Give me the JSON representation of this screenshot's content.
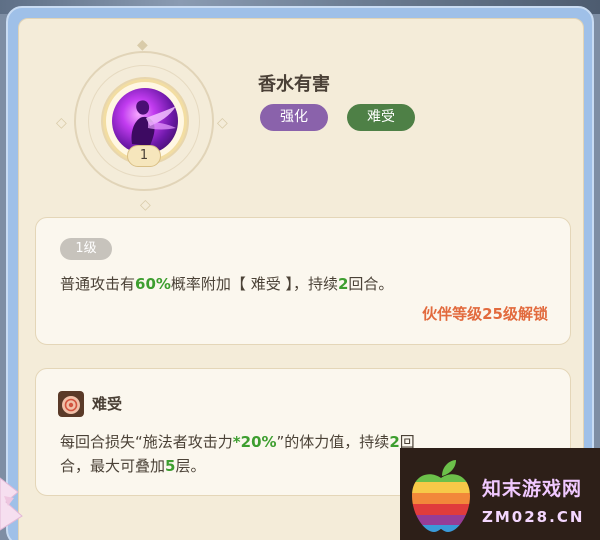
{
  "skill": {
    "name": "香水有害",
    "level_chip": "1",
    "tags": [
      {
        "label": "强化",
        "color": "#8a62ab"
      },
      {
        "label": "难受",
        "color": "#4e8046"
      }
    ]
  },
  "card_level": {
    "badge": "1级",
    "desc": {
      "p1": "普通攻击有",
      "chance": "60%",
      "p2": "概率附加【 难受 】，持续",
      "turns": "2",
      "p3": "回合。"
    },
    "unlock": "伙伴等级25级解锁"
  },
  "card_debuff": {
    "title": "难受",
    "desc": {
      "p1": "每回合损失“施法者攻击力",
      "percent": "*20%",
      "p2": "”的体力值，持续",
      "turns": "2",
      "p3": "回",
      "line2_p1": "合，最大可叠加",
      "stacks": "5",
      "line2_p2": "层。"
    }
  },
  "watermark": {
    "cn": "知末游戏网",
    "en": "ZM028.CN"
  },
  "colors": {
    "highlight_green": "#3d9e2f",
    "unlock_orange": "#e26a3d",
    "panel_bg": "#f4ecd9"
  },
  "icons": {
    "skill": "purple-figure-skill-icon",
    "debuff": "swirl-debuff-icon",
    "watermark_logo": "rainbow-apple-logo-icon"
  }
}
